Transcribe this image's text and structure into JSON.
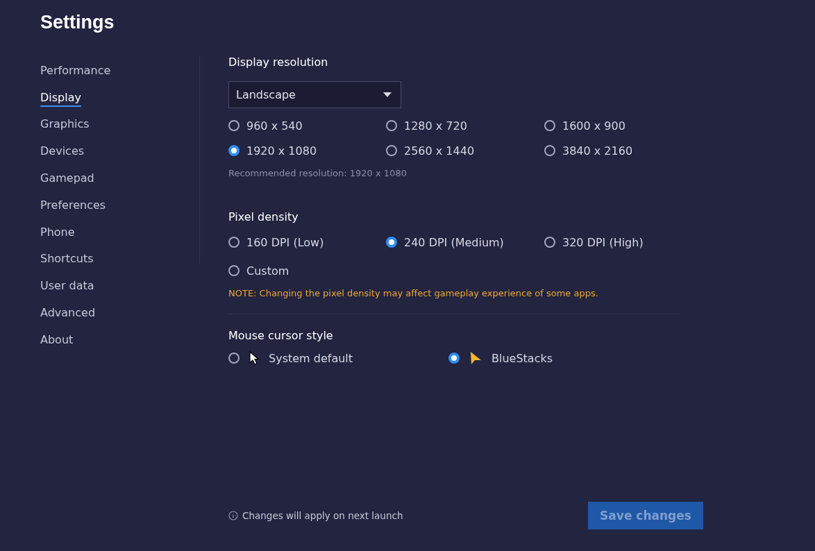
{
  "title": "Settings",
  "sidebar": {
    "items": [
      {
        "label": "Performance",
        "selected": false
      },
      {
        "label": "Display",
        "selected": true
      },
      {
        "label": "Graphics",
        "selected": false
      },
      {
        "label": "Devices",
        "selected": false
      },
      {
        "label": "Gamepad",
        "selected": false
      },
      {
        "label": "Preferences",
        "selected": false
      },
      {
        "label": "Phone",
        "selected": false
      },
      {
        "label": "Shortcuts",
        "selected": false
      },
      {
        "label": "User data",
        "selected": false
      },
      {
        "label": "Advanced",
        "selected": false
      },
      {
        "label": "About",
        "selected": false
      }
    ]
  },
  "display_resolution": {
    "heading": "Display resolution",
    "orientation": "Landscape",
    "options": [
      {
        "label": "960 x 540",
        "selected": false
      },
      {
        "label": "1280 x 720",
        "selected": false
      },
      {
        "label": "1600 x 900",
        "selected": false
      },
      {
        "label": "1920 x 1080",
        "selected": true
      },
      {
        "label": "2560 x 1440",
        "selected": false
      },
      {
        "label": "3840 x 2160",
        "selected": false
      }
    ],
    "hint": "Recommended resolution: 1920 x 1080"
  },
  "pixel_density": {
    "heading": "Pixel density",
    "options": [
      {
        "label": "160 DPI (Low)",
        "selected": false
      },
      {
        "label": "240 DPI (Medium)",
        "selected": true
      },
      {
        "label": "320 DPI (High)",
        "selected": false
      },
      {
        "label": "Custom",
        "selected": false
      }
    ],
    "note": "NOTE: Changing the pixel density may affect gameplay experience of some apps."
  },
  "mouse_cursor_style": {
    "heading": "Mouse cursor style",
    "options": [
      {
        "label": "System default",
        "kind": "system",
        "selected": false
      },
      {
        "label": "BlueStacks",
        "kind": "bluestacks",
        "selected": true
      }
    ]
  },
  "footer": {
    "info": "Changes will apply on next launch",
    "save_button": {
      "label": "Save changes",
      "disabled": true
    }
  }
}
